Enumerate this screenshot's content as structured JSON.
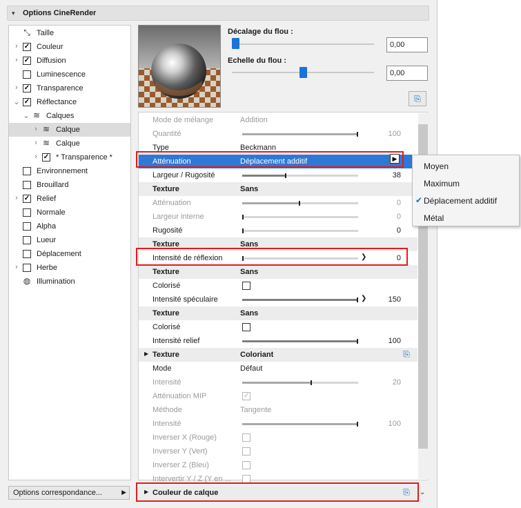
{
  "header": {
    "title": "Options CineRender"
  },
  "tree": [
    {
      "label": "Taille",
      "indent": 0,
      "expander": "",
      "checkbox": "none",
      "icon": "resize-icon"
    },
    {
      "label": "Couleur",
      "indent": 0,
      "expander": "›",
      "checkbox": "checked"
    },
    {
      "label": "Diffusion",
      "indent": 0,
      "expander": "›",
      "checkbox": "checked"
    },
    {
      "label": "Luminescence",
      "indent": 0,
      "expander": "",
      "checkbox": "unchecked"
    },
    {
      "label": "Transparence",
      "indent": 0,
      "expander": "›",
      "checkbox": "checked"
    },
    {
      "label": "Réflectance",
      "indent": 0,
      "expander": "⌄",
      "checkbox": "checked"
    },
    {
      "label": "Calques",
      "indent": 1,
      "expander": "⌄",
      "checkbox": "none",
      "icon": "layers-icon"
    },
    {
      "label": "Calque",
      "indent": 2,
      "expander": "›",
      "checkbox": "none",
      "icon": "layers-icon",
      "selected": true
    },
    {
      "label": "Calque",
      "indent": 2,
      "expander": "›",
      "checkbox": "none",
      "icon": "layers-icon"
    },
    {
      "label": "* Transparence *",
      "indent": 2,
      "expander": "›",
      "checkbox": "checked"
    },
    {
      "label": "Environnement",
      "indent": 0,
      "expander": "",
      "checkbox": "unchecked"
    },
    {
      "label": "Brouillard",
      "indent": 0,
      "expander": "",
      "checkbox": "unchecked"
    },
    {
      "label": "Relief",
      "indent": 0,
      "expander": "›",
      "checkbox": "checked"
    },
    {
      "label": "Normale",
      "indent": 0,
      "expander": "",
      "checkbox": "unchecked"
    },
    {
      "label": "Alpha",
      "indent": 0,
      "expander": "",
      "checkbox": "unchecked"
    },
    {
      "label": "Lueur",
      "indent": 0,
      "expander": "",
      "checkbox": "unchecked"
    },
    {
      "label": "Déplacement",
      "indent": 0,
      "expander": "",
      "checkbox": "unchecked"
    },
    {
      "label": "Herbe",
      "indent": 0,
      "expander": "›",
      "checkbox": "unchecked"
    },
    {
      "label": "Illumination",
      "indent": 0,
      "expander": "",
      "checkbox": "none",
      "icon": "bulb-icon"
    }
  ],
  "options_button": {
    "label": "Options correspondance...",
    "arrow": "▶"
  },
  "blur": {
    "offset_label": "Décalage du flou :",
    "offset_value": "0,00",
    "offset_level": 0.0,
    "scale_label": "Echelle du flou :",
    "scale_value": "0,00",
    "scale_level": 0.5
  },
  "rows": [
    {
      "kind": "slider",
      "key": "Mode de mélange",
      "value": "Addition",
      "disabled": true
    },
    {
      "kind": "bar",
      "key": "Quantité",
      "fill": 1.0,
      "num": "100",
      "disabled": true
    },
    {
      "kind": "text",
      "key": "Type",
      "value": "Beckmann"
    },
    {
      "kind": "text",
      "key": "Atténuation",
      "value": "Déplacement additif",
      "highlight": true
    },
    {
      "kind": "bar",
      "key": "Largeur / Rugosité",
      "fill": 0.38,
      "num": "38"
    },
    {
      "kind": "header",
      "key": "Texture",
      "value": "Sans"
    },
    {
      "kind": "bar",
      "key": "Atténuation",
      "fill": 0.5,
      "num": "0",
      "disabled": true
    },
    {
      "kind": "bar",
      "key": "Largeur interne",
      "fill": 0.0,
      "num": "0",
      "disabled": true
    },
    {
      "kind": "bar",
      "key": "Rugosité",
      "fill": 0.0,
      "num": "0"
    },
    {
      "kind": "header",
      "key": "Texture",
      "value": "Sans"
    },
    {
      "kind": "bar",
      "key": "Intensité de réflexion",
      "fill": 0.0,
      "num": "0",
      "marker": true
    },
    {
      "kind": "header",
      "key": "Texture",
      "value": "Sans"
    },
    {
      "kind": "check",
      "key": "Colorisé",
      "checked": false
    },
    {
      "kind": "bar",
      "key": "Intensité spéculaire",
      "fill": 1.0,
      "num": "150",
      "marker": true
    },
    {
      "kind": "header",
      "key": "Texture",
      "value": "Sans"
    },
    {
      "kind": "check",
      "key": "Colorisé",
      "checked": false
    },
    {
      "kind": "bar",
      "key": "Intensité relief",
      "fill": 1.0,
      "num": "100"
    },
    {
      "kind": "header",
      "key": "Texture",
      "value": "Coloriant",
      "tri": true,
      "icon": true
    },
    {
      "kind": "text",
      "key": "Mode",
      "value": "Défaut"
    },
    {
      "kind": "bar",
      "key": "Intensité",
      "fill": 0.6,
      "num": "20",
      "disabled": true
    },
    {
      "kind": "check",
      "key": "Atténuation MIP",
      "checked": true,
      "disabled": true
    },
    {
      "kind": "text",
      "key": "Méthode",
      "value": "Tangente",
      "disabled": true
    },
    {
      "kind": "bar",
      "key": "Intensité",
      "fill": 1.0,
      "num": "100",
      "disabled": true
    },
    {
      "kind": "check",
      "key": "Inverser X (Rouge)",
      "checked": false,
      "disabled": true
    },
    {
      "kind": "check",
      "key": "Inverser Y (Vert)",
      "checked": false,
      "disabled": true
    },
    {
      "kind": "check",
      "key": "Inverser Z (Bleu)",
      "checked": false,
      "disabled": true
    },
    {
      "kind": "check",
      "key": "Intervertir Y / Z (Y en ...",
      "checked": false,
      "disabled": true
    },
    {
      "kind": "header",
      "key": "Couleur de calque",
      "value": "",
      "tri": true,
      "icon": true
    }
  ],
  "menu": {
    "items": [
      {
        "label": "Moyen",
        "checked": false
      },
      {
        "label": "Maximum",
        "checked": false
      },
      {
        "label": "Déplacement additif",
        "checked": true
      },
      {
        "label": "Métal",
        "checked": false
      }
    ],
    "check_glyph": "✔"
  },
  "glyphs": {
    "check": "✓",
    "dropdown": "▶",
    "collapse": "▾",
    "row_tri": "▶",
    "scroll_down": "⌄",
    "marker": "❯"
  }
}
